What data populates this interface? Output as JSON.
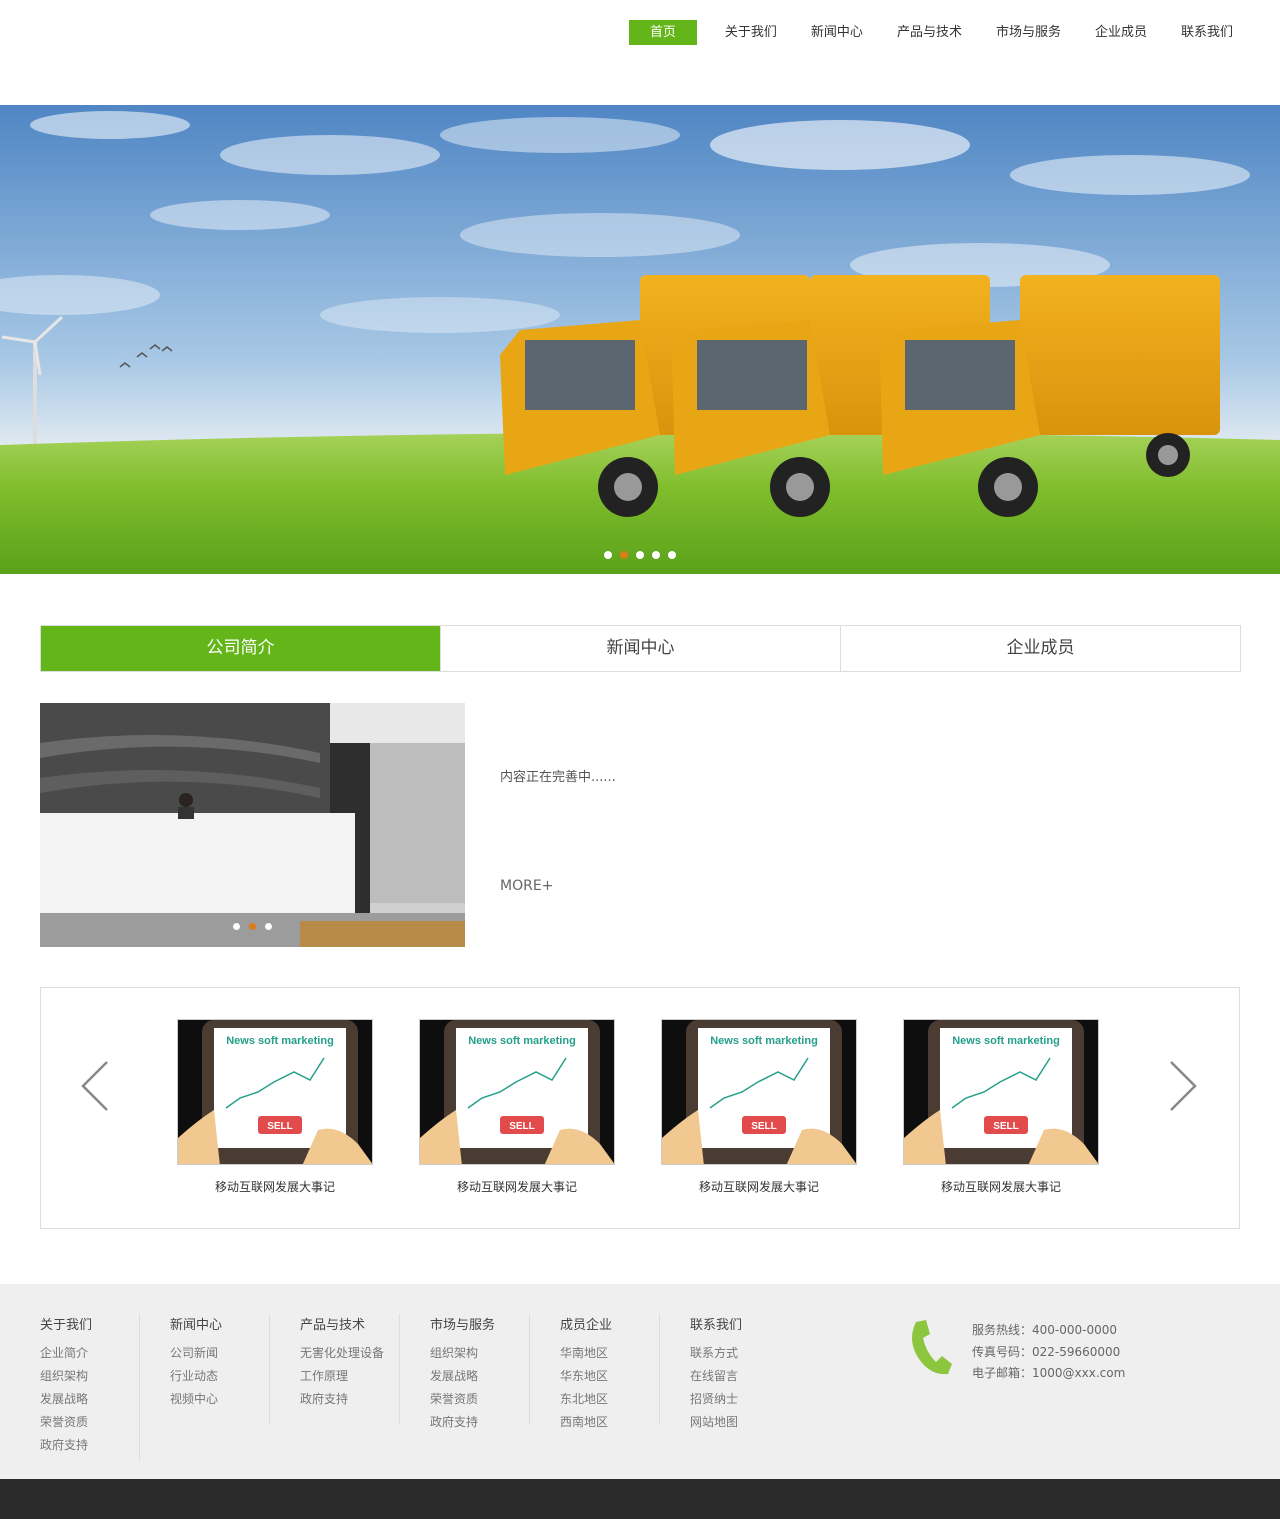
{
  "nav": {
    "items": [
      "首页",
      "关于我们",
      "新闻中心",
      "产品与技术",
      "市场与服务",
      "企业成员",
      "联系我们"
    ],
    "active_index": 0
  },
  "banner": {
    "slide_count": 5,
    "active_slide": 2
  },
  "tabs": {
    "items": [
      "公司简介",
      "新闻中心",
      "企业成员"
    ],
    "active_index": 0
  },
  "intro": {
    "text": "内容正在完善中......",
    "more": "MORE+",
    "slide_count": 3,
    "active_slide": 2
  },
  "carousel": {
    "cards": [
      {
        "title": "移动互联网发展大事记",
        "image_caption": "News soft marketing",
        "image_button": "SELL"
      },
      {
        "title": "移动互联网发展大事记",
        "image_caption": "News soft marketing",
        "image_button": "SELL"
      },
      {
        "title": "移动互联网发展大事记",
        "image_caption": "News soft marketing",
        "image_button": "SELL"
      },
      {
        "title": "移动互联网发展大事记",
        "image_caption": "News soft marketing",
        "image_button": "SELL"
      }
    ]
  },
  "footer": {
    "columns": [
      {
        "title": "关于我们",
        "links": [
          "企业简介",
          "组织架构",
          "发展战略",
          "荣誉资质",
          "政府支持"
        ]
      },
      {
        "title": "新闻中心",
        "links": [
          "公司新闻",
          "行业动态",
          "视频中心"
        ]
      },
      {
        "title": "产品与技术",
        "links": [
          "无害化处理设备",
          "工作原理",
          "政府支持"
        ]
      },
      {
        "title": "市场与服务",
        "links": [
          "组织架构",
          "发展战略",
          "荣誉资质",
          "政府支持"
        ]
      },
      {
        "title": "成员企业",
        "links": [
          "华南地区",
          "华东地区",
          "东北地区",
          "西南地区"
        ]
      },
      {
        "title": "联系我们",
        "links": [
          "联系方式",
          "在线留言",
          "招贤纳士",
          "网站地图"
        ]
      }
    ],
    "contact": {
      "hotline": "服务热线：400-000-0000",
      "fax": "传真号码：022-59660000",
      "email": "电子邮箱：1000@xxx.com"
    }
  },
  "colors": {
    "accent": "#63b519",
    "dot_active": "#e07b1a",
    "footer_bg": "#efefef",
    "bottom_bar": "#2a2a2a"
  },
  "icons": {
    "phone": "phone-icon",
    "arrow_left": "chevron-left-icon",
    "arrow_right": "chevron-right-icon"
  }
}
